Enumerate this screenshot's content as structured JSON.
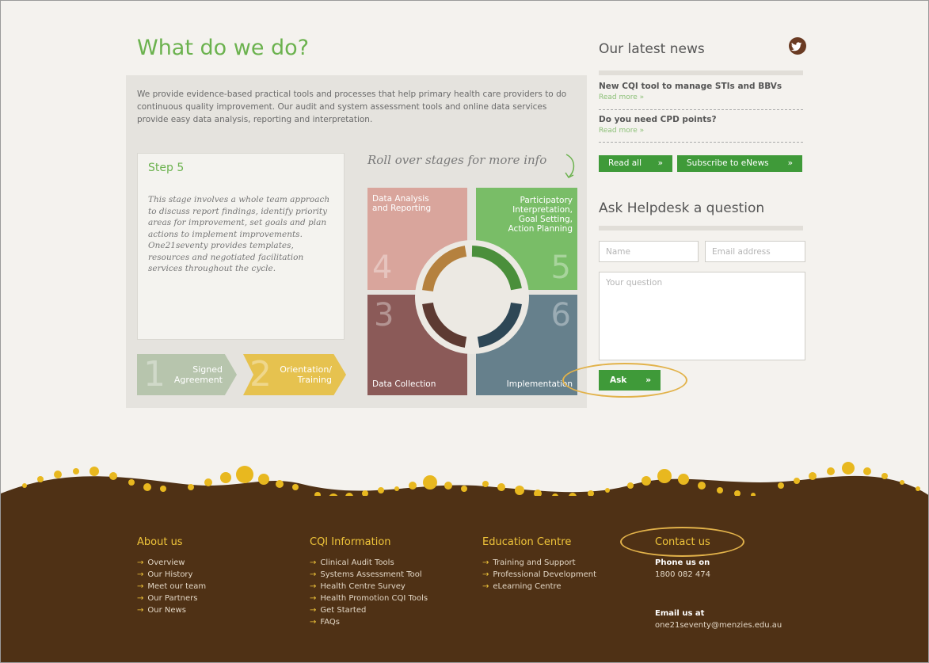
{
  "main": {
    "title": "What do we do?",
    "intro": "We provide evidence-based practical tools and processes that help primary health care providers to do continuous quality improvement. Our audit and system assessment tools and online data services provide easy data analysis, reporting and interpretation.",
    "step": {
      "title": "Step 5",
      "text": "This stage involves a whole team approach to discuss report findings, identify priority areas for improvement, set goals and plan actions to implement improvements. One21seventy provides templates, resources and negotiated facilitation services throughout the cycle."
    },
    "chevrons": [
      {
        "number": "1",
        "label_line1": "Signed",
        "label_line2": "Agreement",
        "color": "#b7c5ad"
      },
      {
        "number": "2",
        "label_line1": "Orientation/",
        "label_line2": "Training",
        "color": "#e6c24f"
      }
    ],
    "rollover_hint": "Roll over stages for more info",
    "stages": {
      "s4": {
        "number": "4",
        "label_line1": "Data Analysis",
        "label_line2": "and Reporting",
        "color": "#d9a59c"
      },
      "s5": {
        "number": "5",
        "label_line1": "Participatory",
        "label_line2": "Interpretation,",
        "label_line3": "Goal Setting,",
        "label_line4": "Action Planning",
        "color": "#79bd67"
      },
      "s3": {
        "number": "3",
        "label": "Data Collection",
        "color": "#8b5a58"
      },
      "s6": {
        "number": "6",
        "label": "Implementation",
        "color": "#66808c"
      }
    }
  },
  "news": {
    "title": "Our latest news",
    "items": [
      {
        "title": "New CQI tool to manage STIs and BBVs",
        "more": "Read more »"
      },
      {
        "title": "Do you need CPD points?",
        "more": "Read more »"
      }
    ],
    "read_all": "Read all",
    "subscribe": "Subscribe to eNews",
    "chevron": "»"
  },
  "helpdesk": {
    "title": "Ask Helpdesk a question",
    "name_placeholder": "Name",
    "email_placeholder": "Email address",
    "question_placeholder": "Your question",
    "ask": "Ask",
    "chevron": "»"
  },
  "footer": {
    "about": {
      "heading": "About us",
      "items": [
        "Overview",
        "Our History",
        "Meet our team",
        "Our Partners",
        "Our News"
      ]
    },
    "cqi": {
      "heading": "CQI Information",
      "items": [
        "Clinical Audit Tools",
        "Systems Assessment Tool",
        "Health Centre Survey",
        "Health Promotion CQI Tools",
        "Get Started",
        "FAQs"
      ]
    },
    "education": {
      "heading": "Education Centre",
      "items": [
        "Training and Support",
        "Professional Development",
        "eLearning Centre"
      ]
    },
    "contact": {
      "heading": "Contact us",
      "phone_label": "Phone us on",
      "phone": "1800 082 474",
      "email_label": "Email us at",
      "email": "one21seventy@menzies.edu.au"
    },
    "arrow": "→"
  },
  "colors": {
    "accent_green": "#6bb24e",
    "button_green": "#3f9a39",
    "footer_brown": "#4f3115",
    "footer_gold": "#f0c53a",
    "highlight_ring": "#e2b24a"
  }
}
